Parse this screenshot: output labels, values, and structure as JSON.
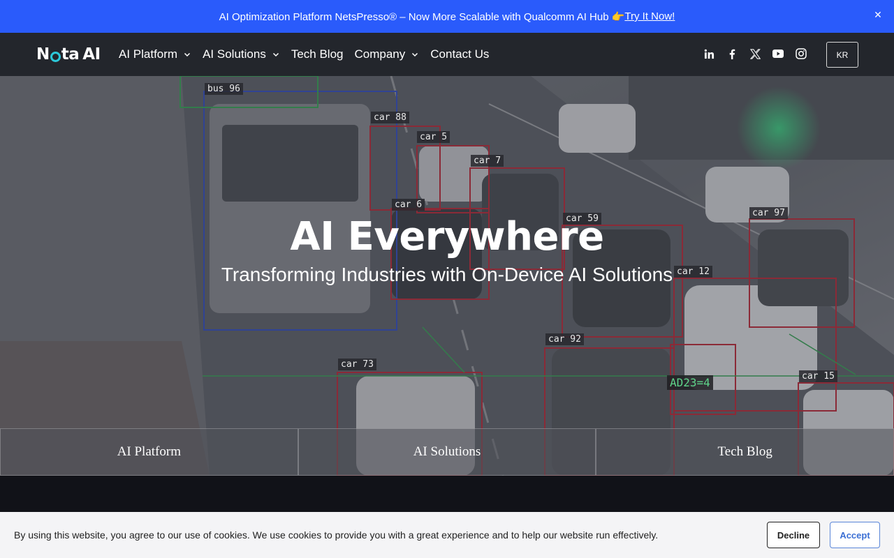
{
  "announcement": {
    "text": "AI Optimization Platform NetsPresso® – Now More Scalable with Qualcomm AI Hub 👉",
    "link": "Try It Now!",
    "close_icon": "close-icon"
  },
  "nav": {
    "logo": {
      "n": "N",
      "rest": "ta",
      "ai": "AI"
    },
    "menu": [
      {
        "label": "AI Platform",
        "dropdown": true
      },
      {
        "label": "AI Solutions",
        "dropdown": true
      },
      {
        "label": "Tech Blog",
        "dropdown": false
      },
      {
        "label": "Company",
        "dropdown": true
      },
      {
        "label": "Contact Us",
        "dropdown": false
      }
    ],
    "social": [
      "linkedin-icon",
      "facebook-icon",
      "x-icon",
      "youtube-icon",
      "instagram-icon"
    ],
    "language": "KR"
  },
  "hero": {
    "title": "AI Everywhere",
    "subtitle": "Transforming Industries with On-Device AI Solutions",
    "detections": [
      "bus 96",
      "car 88",
      "car 5",
      "car 7",
      "car 6",
      "car 59",
      "car 97",
      "car 12",
      "car 92",
      "car 73",
      "AD23=4",
      "car 15"
    ],
    "tiles": [
      {
        "label": "AI Platform"
      },
      {
        "label": "AI Solutions"
      },
      {
        "label": "Tech Blog"
      }
    ]
  },
  "cookie": {
    "message": "By using this website, you agree to our use of cookies. We use cookies to provide you with a great experience and to help our website run effectively.",
    "decline": "Decline",
    "accept": "Accept"
  },
  "colors": {
    "announce_bg": "#2a5bfb",
    "nav_bg": "#23262c",
    "logo_accent": "#2cc7d8",
    "accept_text": "#3b6fd4"
  }
}
